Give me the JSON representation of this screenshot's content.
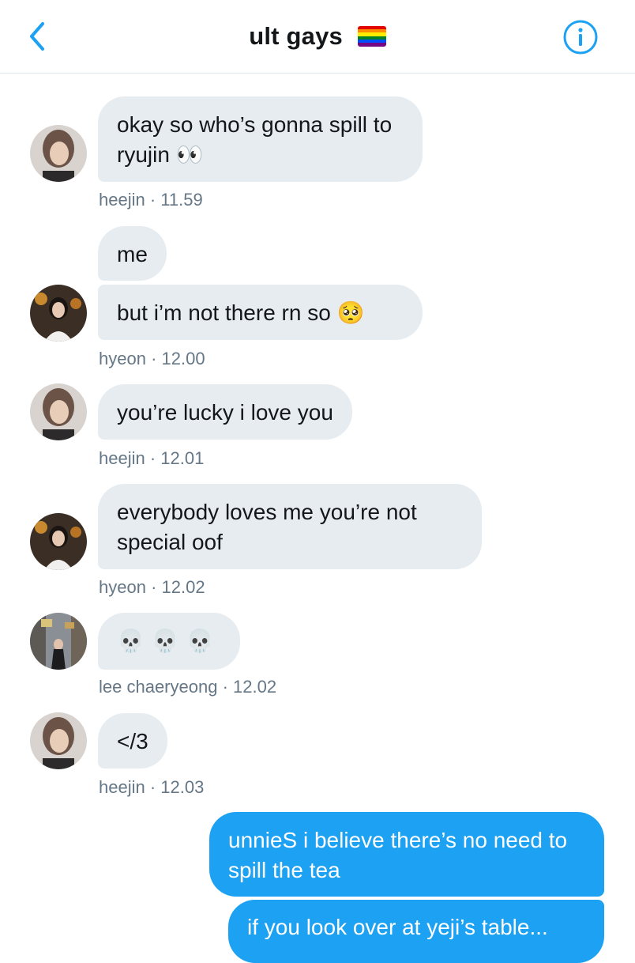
{
  "header": {
    "title": "ult gays",
    "back_icon": "chevron-left-icon",
    "info_icon": "info-icon",
    "accent": "#1da1f2",
    "flag_colors": [
      "#e40303",
      "#ff8c00",
      "#ffed00",
      "#008026",
      "#004dff",
      "#750787"
    ]
  },
  "messages": [
    {
      "text": "okay so who’s gonna spill to ryujin",
      "emoji": "👀",
      "sender": "heejin",
      "time": "11.59"
    },
    {
      "text": "me"
    },
    {
      "text": "but i’m not there rn so",
      "emoji": "🥺",
      "sender": "hyeon",
      "time": "12.00"
    },
    {
      "text": "you’re lucky i love you",
      "sender": "heejin",
      "time": "12.01"
    },
    {
      "text": "everybody loves me you’re not special oof",
      "sender": "hyeon",
      "time": "12.02"
    },
    {
      "emoji": "💀 💀 💀",
      "sender": "lee chaeryeong",
      "time": "12.02"
    },
    {
      "text": "</3",
      "sender": "heejin",
      "time": "12.03"
    }
  ],
  "my_messages": [
    {
      "text": "unnieS i believe there’s no need to spill the tea"
    },
    {
      "text": "if you look over at yeji’s table..."
    }
  ],
  "meta_separator": "·",
  "colors": {
    "incoming_bubble": "#e6ecf0",
    "outgoing_bubble": "#1da1f2",
    "meta_text": "#657786"
  }
}
